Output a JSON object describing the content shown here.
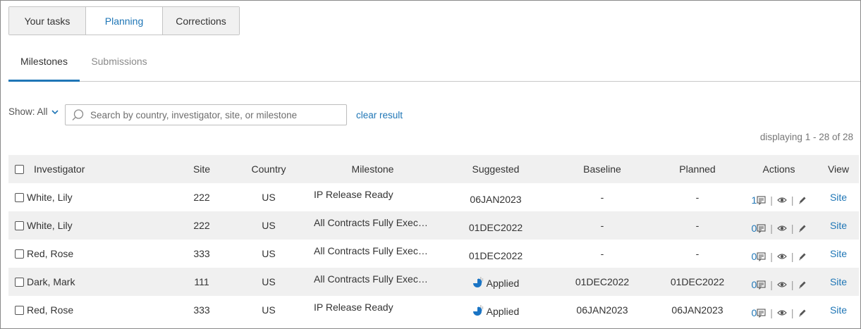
{
  "top_tabs": [
    {
      "label": "Your tasks",
      "active": false
    },
    {
      "label": "Planning",
      "active": true
    },
    {
      "label": "Corrections",
      "active": false
    }
  ],
  "sub_tabs": [
    {
      "label": "Milestones",
      "active": true
    },
    {
      "label": "Submissions",
      "active": false
    }
  ],
  "filter": {
    "show_label": "Show: All",
    "search_placeholder": "Search by country, investigator, site, or milestone",
    "clear_label": "clear result"
  },
  "display_count": "displaying 1 - 28 of 28",
  "table": {
    "headers": {
      "investigator": "Investigator",
      "site": "Site",
      "country": "Country",
      "milestone": "Milestone",
      "suggested": "Suggested",
      "baseline": "Baseline",
      "planned": "Planned",
      "actions": "Actions",
      "view": "View"
    },
    "rows": [
      {
        "investigator": "White, Lily",
        "site": "222",
        "country": "US",
        "milestone": "IP Release Ready",
        "suggested": "06JAN2023",
        "baseline": "-",
        "planned": "-",
        "comments": "1",
        "view": "Site"
      },
      {
        "investigator": "White, Lily",
        "site": "222",
        "country": "US",
        "milestone": "All Contracts Fully Exec…",
        "suggested": "01DEC2022",
        "baseline": "-",
        "planned": "-",
        "comments": "0",
        "view": "Site"
      },
      {
        "investigator": "Red, Rose",
        "site": "333",
        "country": "US",
        "milestone": "All Contracts Fully Exec…",
        "suggested": "01DEC2022",
        "baseline": "-",
        "planned": "-",
        "comments": "0",
        "view": "Site"
      },
      {
        "investigator": "Dark, Mark",
        "site": "111",
        "country": "US",
        "milestone": "All Contracts Fully Exec…",
        "suggested": "Applied",
        "baseline": "01DEC2022",
        "planned": "01DEC2022",
        "comments": "0",
        "view": "Site"
      },
      {
        "investigator": "Red, Rose",
        "site": "333",
        "country": "US",
        "milestone": "IP Release Ready",
        "suggested": "Applied",
        "baseline": "06JAN2023",
        "planned": "06JAN2023",
        "comments": "0",
        "view": "Site"
      }
    ]
  },
  "colors": {
    "accent": "#1f76b6",
    "row_alt": "#f0f0f0",
    "applied_icon": "#1a74c4"
  },
  "icons": {
    "comment": "comment-icon",
    "view": "eye-icon",
    "edit": "pencil-icon",
    "applied": "pie-chart-icon",
    "search": "search-icon"
  }
}
